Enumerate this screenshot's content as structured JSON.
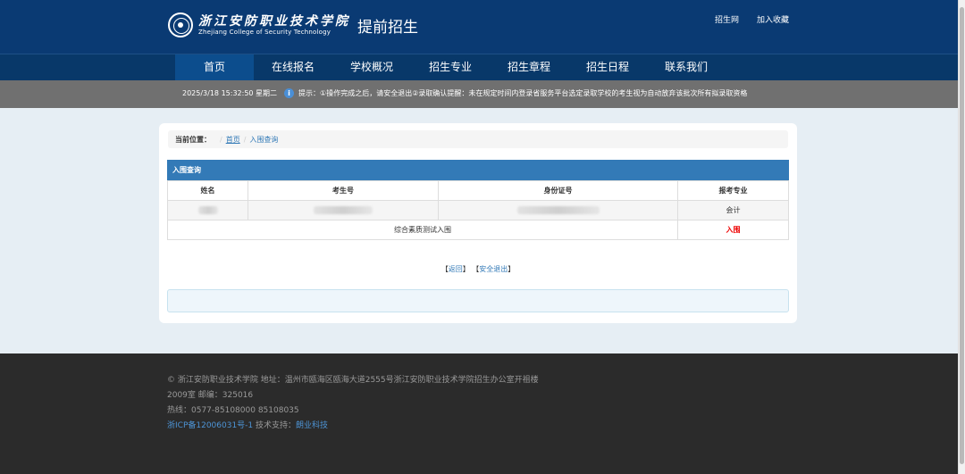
{
  "header": {
    "logo_cn": "浙江安防职业技术学院",
    "logo_en": "Zhejiang College of Security Technology",
    "subtitle": "提前招生",
    "links": [
      "招生网",
      "加入收藏"
    ]
  },
  "nav": {
    "items": [
      "首页",
      "在线报名",
      "学校概况",
      "招生专业",
      "招生章程",
      "招生日程",
      "联系我们"
    ],
    "active": "首页"
  },
  "notice": {
    "datetime": "2025/3/18 15:32:50 星期二",
    "icon": "info-icon",
    "text": "提示：①操作完成之后，请安全退出②录取确认提醒：未在规定时间内登录省服务平台选定录取学校的考生视为自动放弃该批次所有拟录取资格"
  },
  "breadcrumb": {
    "label": "当前位置：",
    "items": [
      "首页",
      "入围查询"
    ]
  },
  "panel": {
    "title": "入围查询",
    "columns": [
      "姓名",
      "考生号",
      "身份证号",
      "报考专业"
    ],
    "row": {
      "major": "会计"
    },
    "result_label": "综合素质测试入围",
    "result_status": "入围"
  },
  "actions": {
    "back": "返回",
    "logout": "安全退出"
  },
  "footer": {
    "line1": "© 浙江安防职业技术学院 地址：温州市瓯海区瓯海大道2555号浙江安防职业技术学院招生办公室开祖楼",
    "line2": "2009室 邮编：325016",
    "line3": "热线：0577-85108000 85108035",
    "icp": "浙ICP备12006031号-1",
    "support_label": " 技术支持：",
    "support": "朗业科技"
  },
  "colors": {
    "header_bg": "#0a3a73",
    "nav_bg": "#083869",
    "notice_bg": "#707070",
    "panel_head": "#337ab7",
    "status_red": "#ee0000",
    "footer_bg": "#2b2b2b"
  }
}
